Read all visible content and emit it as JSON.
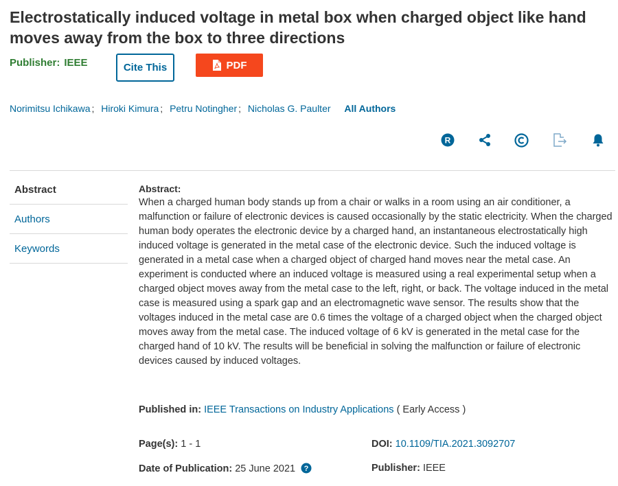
{
  "article": {
    "title": "Electrostatically induced voltage in metal box when charged object like hand moves away from the box to three directions",
    "publisher_label": "Publisher:",
    "publisher_value": "IEEE"
  },
  "buttons": {
    "cite": "Cite This",
    "pdf": "PDF"
  },
  "authors": {
    "names": [
      "Norimitsu Ichikawa",
      "Hiroki Kimura",
      "Petru Notingher",
      "Nicholas G. Paulter"
    ],
    "all_label": "All Authors"
  },
  "icons": [
    "rights-icon",
    "share-icon",
    "copyright-icon",
    "export-icon",
    "alert-bell-icon"
  ],
  "colors": {
    "link": "#006699",
    "pdf": "#f5471d",
    "publisher": "#2f7d32"
  },
  "sidebar": {
    "items": [
      {
        "label": "Abstract"
      },
      {
        "label": "Authors"
      },
      {
        "label": "Keywords"
      }
    ]
  },
  "abstract": {
    "heading": "Abstract:",
    "text": "When a charged human body stands up from a chair or walks in a room using an air conditioner, a malfunction or failure of electronic devices is caused occasionally by the static electricity. When the charged human body operates the electronic device by a charged hand, an instantaneous electrostatically high induced voltage is generated in the metal case of the electronic device. Such the induced voltage is generated in a metal case when a charged object of charged hand moves near the metal case. An experiment is conducted where an induced voltage is measured using a real experimental setup when a charged object moves away from the metal case to the left, right, or back. The voltage induced in the metal case is measured using a spark gap and an electromagnetic wave sensor. The results show that the voltages induced in the metal case are 0.6 times the voltage of a charged object when the charged object moves away from the metal case. The induced voltage of 6 kV is generated in the metal case for the charged hand of 10 kV. The results will be beneficial in solving the malfunction or failure of electronic devices caused by induced voltages."
  },
  "meta": {
    "published_in_label": "Published in:",
    "journal": "IEEE Transactions on Industry Applications",
    "access": "( Early Access )",
    "pages_label": "Page(s):",
    "pages_value": "1 - 1",
    "doi_label": "DOI:",
    "doi_value": "10.1109/TIA.2021.3092707",
    "date_label": "Date of Publication:",
    "date_value": "25 June 2021",
    "publisher_label": "Publisher:",
    "publisher_value": "IEEE"
  }
}
